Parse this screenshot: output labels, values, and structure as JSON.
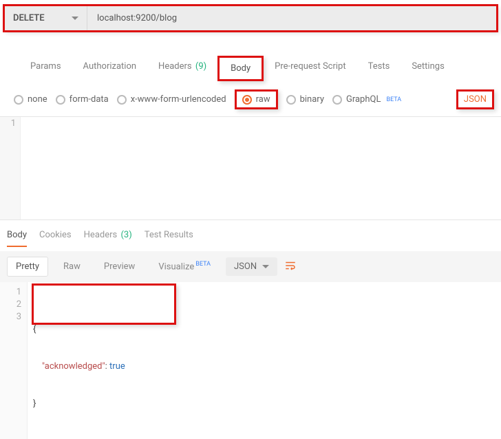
{
  "request": {
    "method": "DELETE",
    "url": "localhost:9200/blog"
  },
  "req_tabs": {
    "params": "Params",
    "auth": "Authorization",
    "headers_label": "Headers",
    "headers_count": "(9)",
    "body": "Body",
    "prereq": "Pre-request Script",
    "tests": "Tests",
    "settings": "Settings"
  },
  "body_options": {
    "none": "none",
    "formdata": "form-data",
    "urlencoded": "x-www-form-urlencoded",
    "raw": "raw",
    "binary": "binary",
    "graphql": "GraphQL",
    "beta": "BETA",
    "content_type": "JSON"
  },
  "editor": {
    "line1": "1"
  },
  "resp_tabs": {
    "body": "Body",
    "cookies": "Cookies",
    "headers_label": "Headers",
    "headers_count": "(3)",
    "tests": "Test Results"
  },
  "resp_toolbar": {
    "pretty": "Pretty",
    "raw": "Raw",
    "preview": "Preview",
    "visualize": "Visualize",
    "beta": "BETA",
    "type": "JSON"
  },
  "response": {
    "l1": "1",
    "l2": "2",
    "l3": "3",
    "open": "{",
    "key": "\"acknowledged\"",
    "colon": ": ",
    "val": "true",
    "close": "}"
  }
}
